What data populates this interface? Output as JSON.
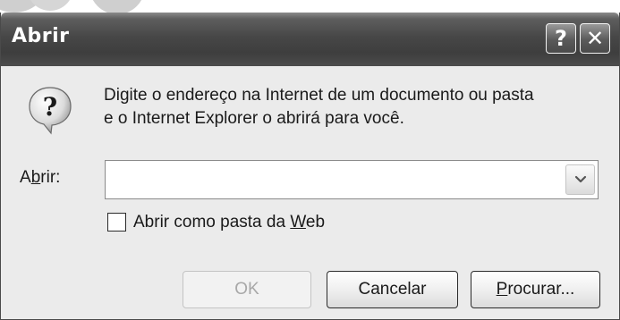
{
  "dialog": {
    "title": "Abrir",
    "help_button": "?",
    "close_button": "✕",
    "message_line1": "Digite o endereço na Internet de um documento ou pasta",
    "message_line2": "e o Internet Explorer o abrirá para você.",
    "open_label_pre": "A",
    "open_label_accel": "b",
    "open_label_post": "rir:",
    "address_value": "",
    "checkbox_checked": false,
    "checkbox_label_pre": "Abrir como pasta da ",
    "checkbox_label_accel": "W",
    "checkbox_label_post": "eb",
    "ok_label": "OK",
    "cancel_label": "Cancelar",
    "browse_accel": "P",
    "browse_label_post": "rocurar...",
    "ok_enabled": false
  },
  "colors": {
    "titlebar": "#474747",
    "window_bg": "#ebebeb",
    "disabled_text": "#a8a8a8"
  },
  "icons": {
    "dialog_icon": "question-bubble-icon",
    "dropdown": "chevron-down-icon"
  }
}
